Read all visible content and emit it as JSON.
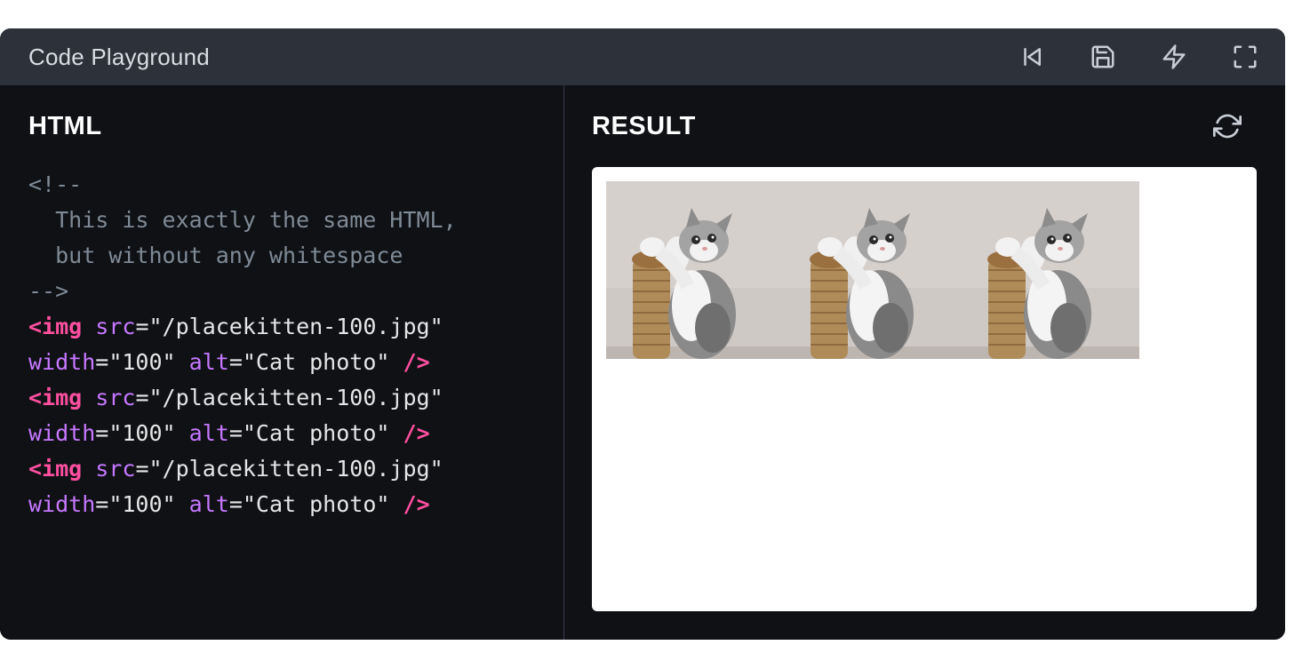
{
  "window": {
    "title": "Code Playground",
    "toolbar": {
      "reset_icon": "skip-back-icon",
      "save_icon": "save-icon",
      "format_icon": "lightning-icon",
      "fullscreen_icon": "fullscreen-icon"
    }
  },
  "html_pane": {
    "heading": "HTML",
    "code_lines": [
      {
        "parts": [
          {
            "cls": "c-comment",
            "text": "<!--"
          }
        ]
      },
      {
        "parts": [
          {
            "cls": "c-comment",
            "text": "  This is exactly the same HTML,"
          }
        ]
      },
      {
        "parts": [
          {
            "cls": "c-comment",
            "text": "  but without any whitespace"
          }
        ]
      },
      {
        "parts": [
          {
            "cls": "c-comment",
            "text": "-->"
          }
        ]
      },
      {
        "parts": [
          {
            "cls": "c-tag",
            "text": "<img"
          },
          {
            "cls": "c-punct",
            "text": " "
          },
          {
            "cls": "c-attr",
            "text": "src"
          },
          {
            "cls": "c-punct",
            "text": "="
          },
          {
            "cls": "c-str",
            "text": "\"/placekitten-100.jpg\""
          }
        ]
      },
      {
        "parts": [
          {
            "cls": "c-attr",
            "text": "width"
          },
          {
            "cls": "c-punct",
            "text": "="
          },
          {
            "cls": "c-str",
            "text": "\"100\""
          },
          {
            "cls": "c-punct",
            "text": " "
          },
          {
            "cls": "c-attr",
            "text": "alt"
          },
          {
            "cls": "c-punct",
            "text": "="
          },
          {
            "cls": "c-str",
            "text": "\"Cat photo\""
          },
          {
            "cls": "c-punct",
            "text": " "
          },
          {
            "cls": "c-tag",
            "text": "/>"
          }
        ]
      },
      {
        "parts": [
          {
            "cls": "c-tag",
            "text": "<img"
          },
          {
            "cls": "c-punct",
            "text": " "
          },
          {
            "cls": "c-attr",
            "text": "src"
          },
          {
            "cls": "c-punct",
            "text": "="
          },
          {
            "cls": "c-str",
            "text": "\"/placekitten-100.jpg\""
          }
        ]
      },
      {
        "parts": [
          {
            "cls": "c-attr",
            "text": "width"
          },
          {
            "cls": "c-punct",
            "text": "="
          },
          {
            "cls": "c-str",
            "text": "\"100\""
          },
          {
            "cls": "c-punct",
            "text": " "
          },
          {
            "cls": "c-attr",
            "text": "alt"
          },
          {
            "cls": "c-punct",
            "text": "="
          },
          {
            "cls": "c-str",
            "text": "\"Cat photo\""
          },
          {
            "cls": "c-punct",
            "text": " "
          },
          {
            "cls": "c-tag",
            "text": "/>"
          }
        ]
      },
      {
        "parts": [
          {
            "cls": "c-tag",
            "text": "<img"
          },
          {
            "cls": "c-punct",
            "text": " "
          },
          {
            "cls": "c-attr",
            "text": "src"
          },
          {
            "cls": "c-punct",
            "text": "="
          },
          {
            "cls": "c-str",
            "text": "\"/placekitten-100.jpg\""
          }
        ]
      },
      {
        "parts": [
          {
            "cls": "c-attr",
            "text": "width"
          },
          {
            "cls": "c-punct",
            "text": "="
          },
          {
            "cls": "c-str",
            "text": "\"100\""
          },
          {
            "cls": "c-punct",
            "text": " "
          },
          {
            "cls": "c-attr",
            "text": "alt"
          },
          {
            "cls": "c-punct",
            "text": "="
          },
          {
            "cls": "c-str",
            "text": "\"Cat photo\""
          },
          {
            "cls": "c-punct",
            "text": " "
          },
          {
            "cls": "c-tag",
            "text": "/>"
          }
        ]
      }
    ]
  },
  "result_pane": {
    "heading": "RESULT",
    "refresh_icon": "refresh-icon",
    "images": [
      {
        "alt": "Cat photo"
      },
      {
        "alt": "Cat photo"
      },
      {
        "alt": "Cat photo"
      }
    ]
  },
  "colors": {
    "titlebar_bg": "#2c313a",
    "editor_bg": "#0f1115",
    "tag": "#ff4fa0",
    "attr": "#c678ff",
    "comment": "#7f8a96"
  }
}
